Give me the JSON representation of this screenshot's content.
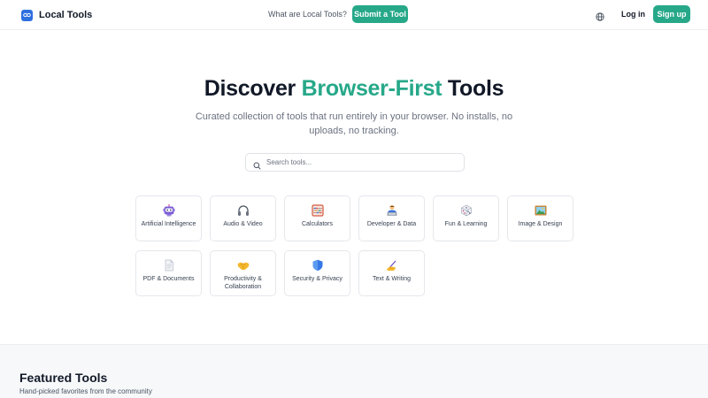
{
  "header": {
    "brand": "Local Tools",
    "nav_link": "What are Local Tools?",
    "submit_label": "Submit a Tool",
    "login_label": "Log in",
    "signup_label": "Sign up",
    "icons": [
      "logo-icon",
      "globe-icon"
    ]
  },
  "hero": {
    "title_part1": "Discover ",
    "title_accent": "Browser-First",
    "title_part2": " Tools",
    "subtitle": "Curated collection of tools that run entirely in your browser. No installs, no uploads, no tracking."
  },
  "search": {
    "placeholder": "Search tools..."
  },
  "categories": [
    {
      "label": "Artificial Intelligence",
      "icon": "robot-icon"
    },
    {
      "label": "Audio & Video",
      "icon": "headphones-icon"
    },
    {
      "label": "Calculators",
      "icon": "abacus-icon"
    },
    {
      "label": "Developer & Data",
      "icon": "developer-icon"
    },
    {
      "label": "Fun & Learning",
      "icon": "dice-icon"
    },
    {
      "label": "Image & Design",
      "icon": "framed-picture-icon"
    },
    {
      "label": "PDF & Documents",
      "icon": "document-icon"
    },
    {
      "label": "Productivity & Collaboration",
      "icon": "handshake-icon"
    },
    {
      "label": "Security & Privacy",
      "icon": "shield-icon"
    },
    {
      "label": "Text & Writing",
      "icon": "writing-hand-icon"
    }
  ],
  "featured": {
    "title": "Featured Tools",
    "subtitle": "Hand-picked favorites from the community"
  },
  "colors": {
    "accent": "#26a889",
    "brand_blue": "#2f6fe0"
  }
}
